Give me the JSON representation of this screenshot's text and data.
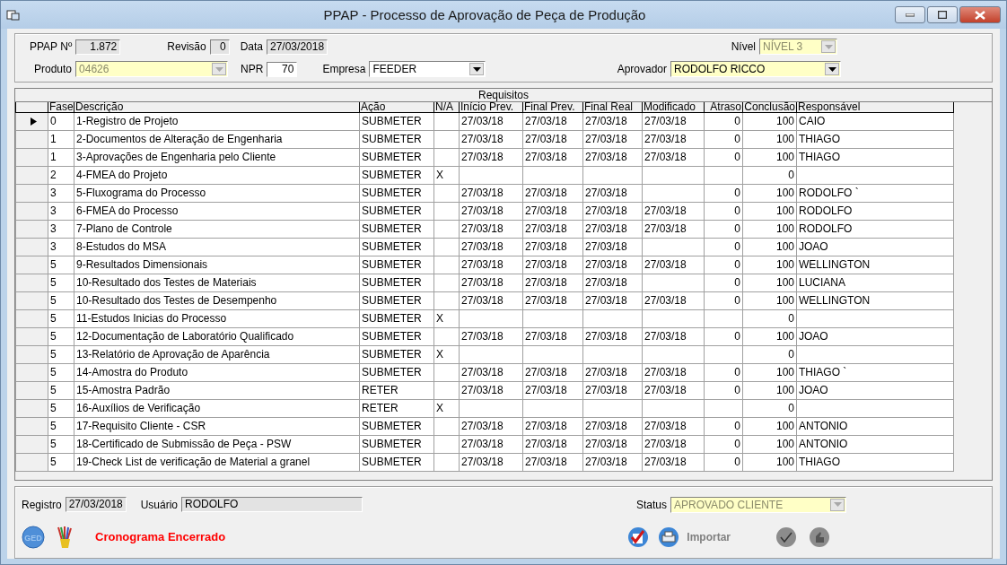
{
  "window": {
    "title": "PPAP - Processo de Aprovação de Peça de Produção"
  },
  "header": {
    "ppap_label": "PPAP Nº",
    "ppap_value": "1.872",
    "revisao_label": "Revisão",
    "revisao_value": "0",
    "data_label": "Data",
    "data_value": "27/03/2018",
    "nivel": {
      "label": "Nível",
      "value": "NÍVEL 3",
      "disabled": true
    },
    "produto": {
      "label": "Produto",
      "value": "04626",
      "disabled": true
    },
    "npr_label": "NPR",
    "npr_value": "70",
    "empresa": {
      "label": "Empresa",
      "value": "FEEDER",
      "disabled": false
    },
    "aprovador": {
      "label": "Aprovador",
      "value": "RODOLFO RICCO",
      "disabled": false
    }
  },
  "table": {
    "title": "Requisitos",
    "columns": [
      "Fase",
      "Descrição",
      "Ação",
      "N/A",
      "Início Prev.",
      "Final Prev.",
      "Final Real",
      "Modificado",
      "Atraso",
      "Conclusão",
      "Responsável"
    ],
    "rows": [
      {
        "selected": true,
        "cells": [
          "0",
          "1-Registro de Projeto",
          "SUBMETER",
          null,
          "27/03/18",
          "27/03/18",
          "27/03/18",
          "27/03/18",
          "0",
          "100",
          "CAIO"
        ]
      },
      {
        "selected": false,
        "cells": [
          "1",
          "2-Documentos de Alteração de Engenharia",
          "SUBMETER",
          null,
          "27/03/18",
          "27/03/18",
          "27/03/18",
          "27/03/18",
          "0",
          "100",
          "THIAGO"
        ]
      },
      {
        "selected": false,
        "cells": [
          "1",
          "3-Aprovações de Engenharia pelo Cliente",
          "SUBMETER",
          null,
          "27/03/18",
          "27/03/18",
          "27/03/18",
          "27/03/18",
          "0",
          "100",
          "THIAGO"
        ]
      },
      {
        "selected": false,
        "cells": [
          "2",
          "4-FMEA do Projeto",
          "SUBMETER",
          "X",
          null,
          null,
          null,
          null,
          null,
          "0",
          null
        ]
      },
      {
        "selected": false,
        "cells": [
          "3",
          "5-Fluxograma do Processo",
          "SUBMETER",
          null,
          "27/03/18",
          "27/03/18",
          "27/03/18",
          null,
          "0",
          "100",
          "RODOLFO `"
        ]
      },
      {
        "selected": false,
        "cells": [
          "3",
          "6-FMEA do Processo",
          "SUBMETER",
          null,
          "27/03/18",
          "27/03/18",
          "27/03/18",
          "27/03/18",
          "0",
          "100",
          "RODOLFO"
        ]
      },
      {
        "selected": false,
        "cells": [
          "3",
          "7-Plano de Controle",
          "SUBMETER",
          null,
          "27/03/18",
          "27/03/18",
          "27/03/18",
          "27/03/18",
          "0",
          "100",
          "RODOLFO"
        ]
      },
      {
        "selected": false,
        "cells": [
          "3",
          "8-Estudos do MSA",
          "SUBMETER",
          null,
          "27/03/18",
          "27/03/18",
          "27/03/18",
          null,
          "0",
          "100",
          "JOAO"
        ]
      },
      {
        "selected": false,
        "cells": [
          "5",
          "9-Resultados Dimensionais",
          "SUBMETER",
          null,
          "27/03/18",
          "27/03/18",
          "27/03/18",
          "27/03/18",
          "0",
          "100",
          "WELLINGTON"
        ]
      },
      {
        "selected": false,
        "cells": [
          "5",
          "10-Resultado dos Testes de Materiais",
          "SUBMETER",
          null,
          "27/03/18",
          "27/03/18",
          "27/03/18",
          null,
          "0",
          "100",
          "LUCIANA"
        ]
      },
      {
        "selected": false,
        "cells": [
          "5",
          "10-Resultado dos Testes de Desempenho",
          "SUBMETER",
          null,
          "27/03/18",
          "27/03/18",
          "27/03/18",
          "27/03/18",
          "0",
          "100",
          "WELLINGTON"
        ]
      },
      {
        "selected": false,
        "cells": [
          "5",
          "11-Estudos Inicias do Processo",
          "SUBMETER",
          "X",
          null,
          null,
          null,
          null,
          null,
          "0",
          null
        ]
      },
      {
        "selected": false,
        "cells": [
          "5",
          "12-Documentação de Laboratório Qualificado",
          "SUBMETER",
          null,
          "27/03/18",
          "27/03/18",
          "27/03/18",
          "27/03/18",
          "0",
          "100",
          "JOAO"
        ]
      },
      {
        "selected": false,
        "cells": [
          "5",
          "13-Relatório de Aprovação de Aparência",
          "SUBMETER",
          "X",
          null,
          null,
          null,
          null,
          null,
          "0",
          null
        ]
      },
      {
        "selected": false,
        "cells": [
          "5",
          "14-Amostra do Produto",
          "SUBMETER",
          null,
          "27/03/18",
          "27/03/18",
          "27/03/18",
          "27/03/18",
          "0",
          "100",
          "THIAGO `"
        ]
      },
      {
        "selected": false,
        "cells": [
          "5",
          "15-Amostra Padrão",
          "RETER",
          null,
          "27/03/18",
          "27/03/18",
          "27/03/18",
          "27/03/18",
          "0",
          "100",
          "JOAO"
        ]
      },
      {
        "selected": false,
        "cells": [
          "5",
          "16-Auxílios de Verificação",
          "RETER",
          "X",
          null,
          null,
          null,
          null,
          null,
          "0",
          null
        ]
      },
      {
        "selected": false,
        "cells": [
          "5",
          "17-Requisito Cliente - CSR",
          "SUBMETER",
          null,
          "27/03/18",
          "27/03/18",
          "27/03/18",
          "27/03/18",
          "0",
          "100",
          "ANTONIO"
        ]
      },
      {
        "selected": false,
        "cells": [
          "5",
          "18-Certificado de Submissão de Peça - PSW",
          "SUBMETER",
          null,
          "27/03/18",
          "27/03/18",
          "27/03/18",
          "27/03/18",
          "0",
          "100",
          "ANTONIO"
        ]
      },
      {
        "selected": false,
        "cells": [
          "5",
          "19-Check List de verificação de Material a granel",
          "SUBMETER",
          null,
          "27/03/18",
          "27/03/18",
          "27/03/18",
          "27/03/18",
          "0",
          "100",
          "THIAGO"
        ]
      }
    ]
  },
  "footer": {
    "registro_label": "Registro",
    "registro_value": "27/03/2018",
    "usuario_label": "Usuário",
    "usuario_value": "RODOLFO",
    "status": {
      "label": "Status",
      "value": "APROVADO CLIENTE",
      "disabled": true
    },
    "ged_label": "GED",
    "message": "Cronograma Encerrado",
    "importar": {
      "label": "Importar",
      "disabled": true
    }
  }
}
